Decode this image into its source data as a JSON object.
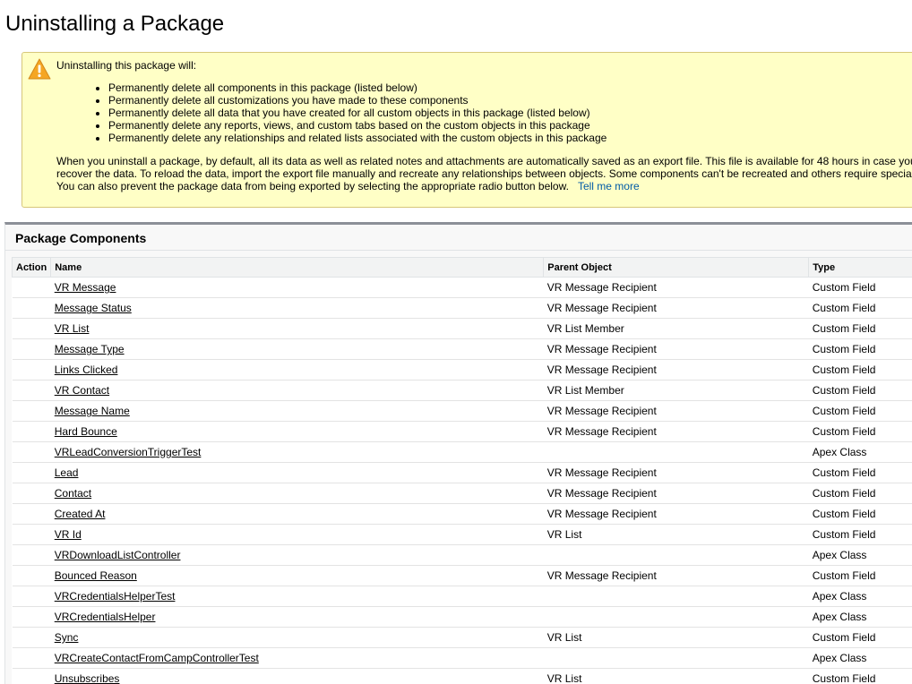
{
  "page": {
    "title": "Uninstalling a Package"
  },
  "warning": {
    "icon": "warning-icon",
    "heading": "Uninstalling this package will:",
    "bullets": [
      "Permanently delete all components in this package (listed below)",
      "Permanently delete all customizations you have made to these components",
      "Permanently delete all data that you have created for all custom objects in this package (listed below)",
      "Permanently delete any reports, views, and custom tabs based on the custom objects in this package",
      "Permanently delete any relationships and related lists associated with the custom objects in this package"
    ],
    "paragraph_lines": [
      "When you uninstall a package, by default, all its data as well as related notes and attachments are automatically saved as an export file. This file is available for 48 hours in case you",
      "recover the data. To reload the data, import the export file manually and recreate any relationships between objects. Some components can't be recreated and others require special",
      "You can also prevent the package data from being exported by selecting the appropriate radio button below."
    ],
    "link_label": "Tell me more",
    "colors": {
      "background": "#ffffc6",
      "border": "#d7c77a",
      "icon": "#f0a22e"
    }
  },
  "components": {
    "title": "Package Components",
    "columns": {
      "action": "Action",
      "name": "Name",
      "parent": "Parent Object",
      "type": "Type"
    },
    "rows": [
      {
        "name": "VR Message",
        "parent": "VR Message Recipient",
        "type": "Custom Field"
      },
      {
        "name": "Message Status",
        "parent": "VR Message Recipient",
        "type": "Custom Field"
      },
      {
        "name": "VR List",
        "parent": "VR List Member",
        "type": "Custom Field"
      },
      {
        "name": "Message Type",
        "parent": "VR Message Recipient",
        "type": "Custom Field"
      },
      {
        "name": "Links Clicked",
        "parent": "VR Message Recipient",
        "type": "Custom Field"
      },
      {
        "name": "VR Contact",
        "parent": "VR List Member",
        "type": "Custom Field"
      },
      {
        "name": "Message Name",
        "parent": "VR Message Recipient",
        "type": "Custom Field"
      },
      {
        "name": "Hard Bounce",
        "parent": "VR Message Recipient",
        "type": "Custom Field"
      },
      {
        "name": "VRLeadConversionTriggerTest",
        "parent": "",
        "type": "Apex Class"
      },
      {
        "name": "Lead",
        "parent": "VR Message Recipient",
        "type": "Custom Field"
      },
      {
        "name": "Contact",
        "parent": "VR Message Recipient",
        "type": "Custom Field"
      },
      {
        "name": "Created At",
        "parent": "VR Message Recipient",
        "type": "Custom Field"
      },
      {
        "name": "VR Id",
        "parent": "VR List",
        "type": "Custom Field"
      },
      {
        "name": "VRDownloadListController",
        "parent": "",
        "type": "Apex Class"
      },
      {
        "name": "Bounced Reason",
        "parent": "VR Message Recipient",
        "type": "Custom Field"
      },
      {
        "name": "VRCredentialsHelperTest",
        "parent": "",
        "type": "Apex Class"
      },
      {
        "name": "VRCredentialsHelper",
        "parent": "",
        "type": "Apex Class"
      },
      {
        "name": "Sync",
        "parent": "VR List",
        "type": "Custom Field"
      },
      {
        "name": "VRCreateContactFromCampControllerTest",
        "parent": "",
        "type": "Apex Class"
      },
      {
        "name": "Unsubscribes",
        "parent": "VR List",
        "type": "Custom Field"
      }
    ]
  }
}
